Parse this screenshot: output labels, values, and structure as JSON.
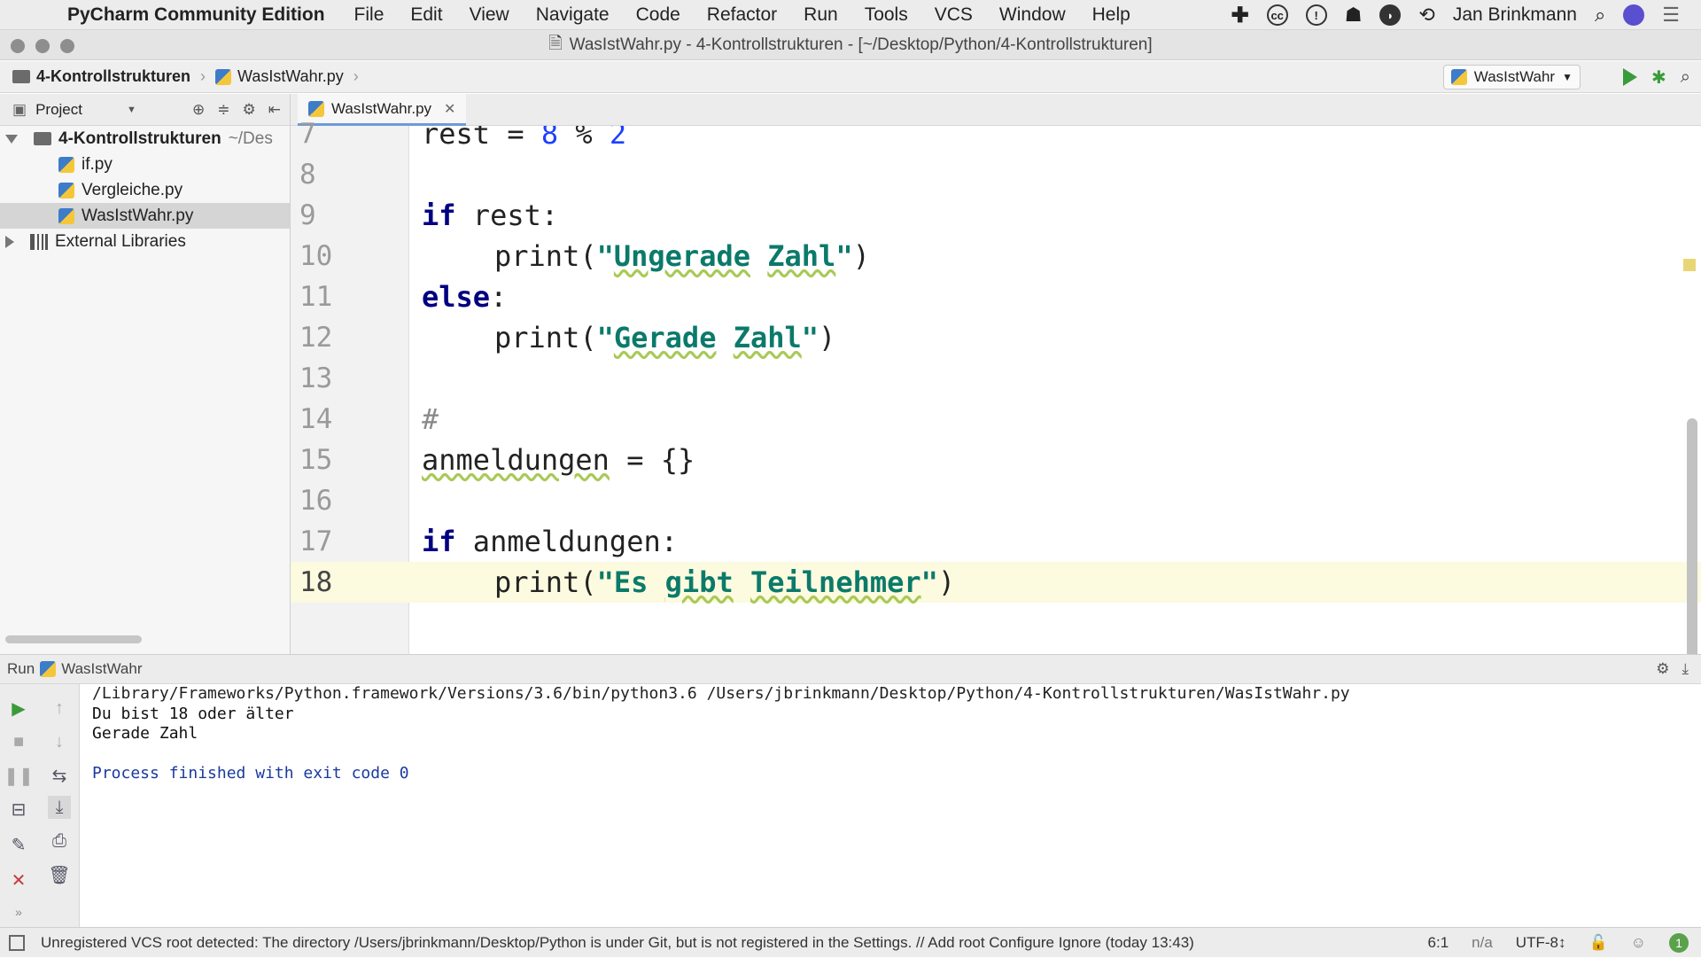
{
  "menubar": {
    "app_name": "PyCharm Community Edition",
    "items": [
      "File",
      "Edit",
      "View",
      "Navigate",
      "Code",
      "Refactor",
      "Run",
      "Tools",
      "VCS",
      "Window",
      "Help"
    ],
    "user": "Jan Brinkmann"
  },
  "window": {
    "title": "WasIstWahr.py - 4-Kontrollstrukturen - [~/Desktop/Python/4-Kontrollstrukturen]"
  },
  "navbar": {
    "crumbs": [
      "4-Kontrollstrukturen",
      "WasIstWahr.py"
    ],
    "run_config": "WasIstWahr"
  },
  "project": {
    "header": "Project",
    "root": "4-Kontrollstrukturen",
    "root_path": "~/Des",
    "files": [
      "if.py",
      "Vergleiche.py",
      "WasIstWahr.py"
    ],
    "external": "External Libraries"
  },
  "editor": {
    "tab": "WasIstWahr.py",
    "line_numbers": [
      "7",
      "8",
      "9",
      "10",
      "11",
      "12",
      "13",
      "14",
      "15",
      "16",
      "17",
      "18"
    ],
    "tokens": {
      "l7_a": "rest = ",
      "l7_b": "8",
      "l7_c": " % ",
      "l7_d": "2",
      "if": "if",
      "l9_rest": " rest:",
      "print": "print",
      "paren_open": "(",
      "paren_close": ")",
      "str_ungerade_q1": "\"",
      "str_ungerade_w1": "Ungerade",
      "str_ungerade_sp": " ",
      "str_ungerade_w2": "Zahl",
      "str_ungerade_q2": "\"",
      "else": "else",
      "colon": ":",
      "str_gerade_q1": "\"",
      "str_gerade_w1": "Gerade",
      "str_gerade_sp": " ",
      "str_gerade_w2": "Zahl",
      "str_gerade_q2": "\"",
      "comment": "#",
      "l15_var": "anmeldungen",
      "l15_rest": " = {}",
      "l17_rest": " anmeldungen:",
      "str_es_q1": "\"",
      "str_es_w1": "Es ",
      "str_es_w2": "gibt",
      "str_es_sp": " ",
      "str_es_w3": "Teilnehmer",
      "str_es_q2": "\""
    }
  },
  "run": {
    "label": "Run",
    "config": "WasIstWahr",
    "output": [
      "/Library/Frameworks/Python.framework/Versions/3.6/bin/python3.6 /Users/jbrinkmann/Desktop/Python/4-Kontrollstrukturen/WasIstWahr.py",
      "Du bist 18 oder älter",
      "Gerade Zahl",
      "",
      "Process finished with exit code 0"
    ]
  },
  "status": {
    "message": "Unregistered VCS root detected: The directory /Users/jbrinkmann/Desktop/Python is under Git, but is not registered in the Settings. // Add root  Configure  Ignore (today 13:43)",
    "position": "6:1",
    "na": "n/a",
    "encoding": "UTF-8↕",
    "notifications": "1"
  }
}
